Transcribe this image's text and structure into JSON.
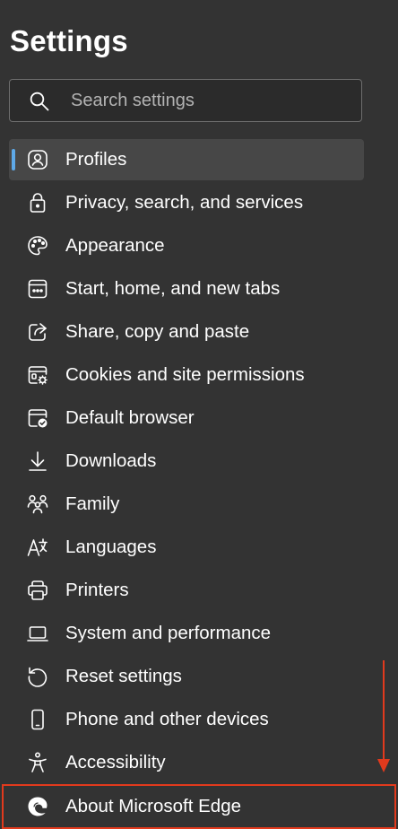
{
  "header": {
    "title": "Settings"
  },
  "search": {
    "placeholder": "Search settings",
    "icon": "search-icon"
  },
  "colors": {
    "background": "#333333",
    "selected_background": "#474747",
    "accent": "#5ea9e8",
    "annotation": "#e23a1d"
  },
  "nav": {
    "items": [
      {
        "label": "Profiles",
        "icon": "profile-icon",
        "selected": true
      },
      {
        "label": "Privacy, search, and services",
        "icon": "lock-icon"
      },
      {
        "label": "Appearance",
        "icon": "palette-icon"
      },
      {
        "label": "Start, home, and new tabs",
        "icon": "start-page-icon"
      },
      {
        "label": "Share, copy and paste",
        "icon": "share-icon"
      },
      {
        "label": "Cookies and site permissions",
        "icon": "cookies-icon"
      },
      {
        "label": "Default browser",
        "icon": "default-browser-icon"
      },
      {
        "label": "Downloads",
        "icon": "download-icon"
      },
      {
        "label": "Family",
        "icon": "family-icon"
      },
      {
        "label": "Languages",
        "icon": "languages-icon"
      },
      {
        "label": "Printers",
        "icon": "printer-icon"
      },
      {
        "label": "System and performance",
        "icon": "laptop-icon"
      },
      {
        "label": "Reset settings",
        "icon": "reset-icon"
      },
      {
        "label": "Phone and other devices",
        "icon": "phone-icon"
      },
      {
        "label": "Accessibility",
        "icon": "accessibility-icon"
      },
      {
        "label": "About Microsoft Edge",
        "icon": "edge-logo-icon",
        "highlighted": true
      }
    ]
  }
}
